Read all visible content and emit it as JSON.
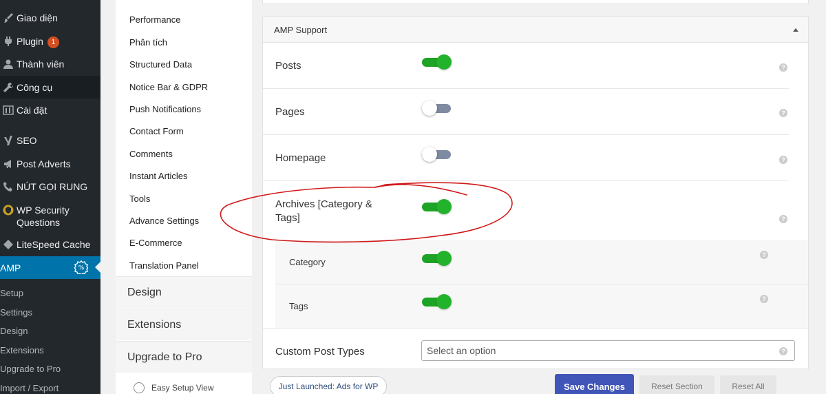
{
  "wp_menu": {
    "items": [
      {
        "label": "Giao diện",
        "icon": "paintbrush-icon"
      },
      {
        "label": "Plugin",
        "icon": "plugin-icon",
        "badge": "1"
      },
      {
        "label": "Thành viên",
        "icon": "users-icon"
      },
      {
        "label": "Công cụ",
        "icon": "wrench-icon"
      },
      {
        "label": "Cài đặt",
        "icon": "settings-sliders-icon"
      },
      {
        "label": "SEO",
        "icon": "yoast-icon"
      },
      {
        "label": "Post Adverts",
        "icon": "megaphone-icon"
      },
      {
        "label": "NÚT GỌI RUNG",
        "icon": "phone-icon"
      },
      {
        "label": "WP Security Questions",
        "icon": "shield-icon"
      },
      {
        "label": "LiteSpeed Cache",
        "icon": "diamond-icon"
      }
    ],
    "active": {
      "label": "AMP",
      "icon": "amp-icon"
    },
    "submenu": [
      "Setup",
      "Settings",
      "Design",
      "Extensions",
      "Upgrade to Pro",
      "Import / Export"
    ]
  },
  "settings_nav": {
    "items": [
      "Performance",
      "Phân tích",
      "Structured Data",
      "Notice Bar & GDPR",
      "Push Notifications",
      "Contact Form",
      "Comments",
      "Instant Articles",
      "Tools",
      "Advance Settings",
      "E-Commerce",
      "Translation Panel"
    ],
    "sections": [
      "Design",
      "Extensions",
      "Upgrade to Pro"
    ],
    "easy_setup_label": "Easy Setup View"
  },
  "panel": {
    "title": "AMP Support",
    "rows": [
      {
        "label": "Posts",
        "enabled": true
      },
      {
        "label": "Pages",
        "enabled": false
      },
      {
        "label": "Homepage",
        "enabled": false
      },
      {
        "label": "Archives [Category & Tags]",
        "enabled": true
      }
    ],
    "sub_rows": [
      {
        "label": "Category",
        "enabled": true
      },
      {
        "label": "Tags",
        "enabled": true
      }
    ],
    "custom_post_types": {
      "label": "Custom Post Types",
      "placeholder": "Select an option"
    },
    "help_glyph": "?"
  },
  "footer": {
    "promo": "Just Launched: Ads for WP",
    "save": "Save Changes",
    "reset_section": "Reset Section",
    "reset_all": "Reset All"
  },
  "colors": {
    "toggle_on": "#22b22b",
    "toggle_off": "#7f8ba1",
    "wp_active": "#0073aa",
    "save_button": "#4154b8",
    "annotation": "#d11a1a"
  }
}
